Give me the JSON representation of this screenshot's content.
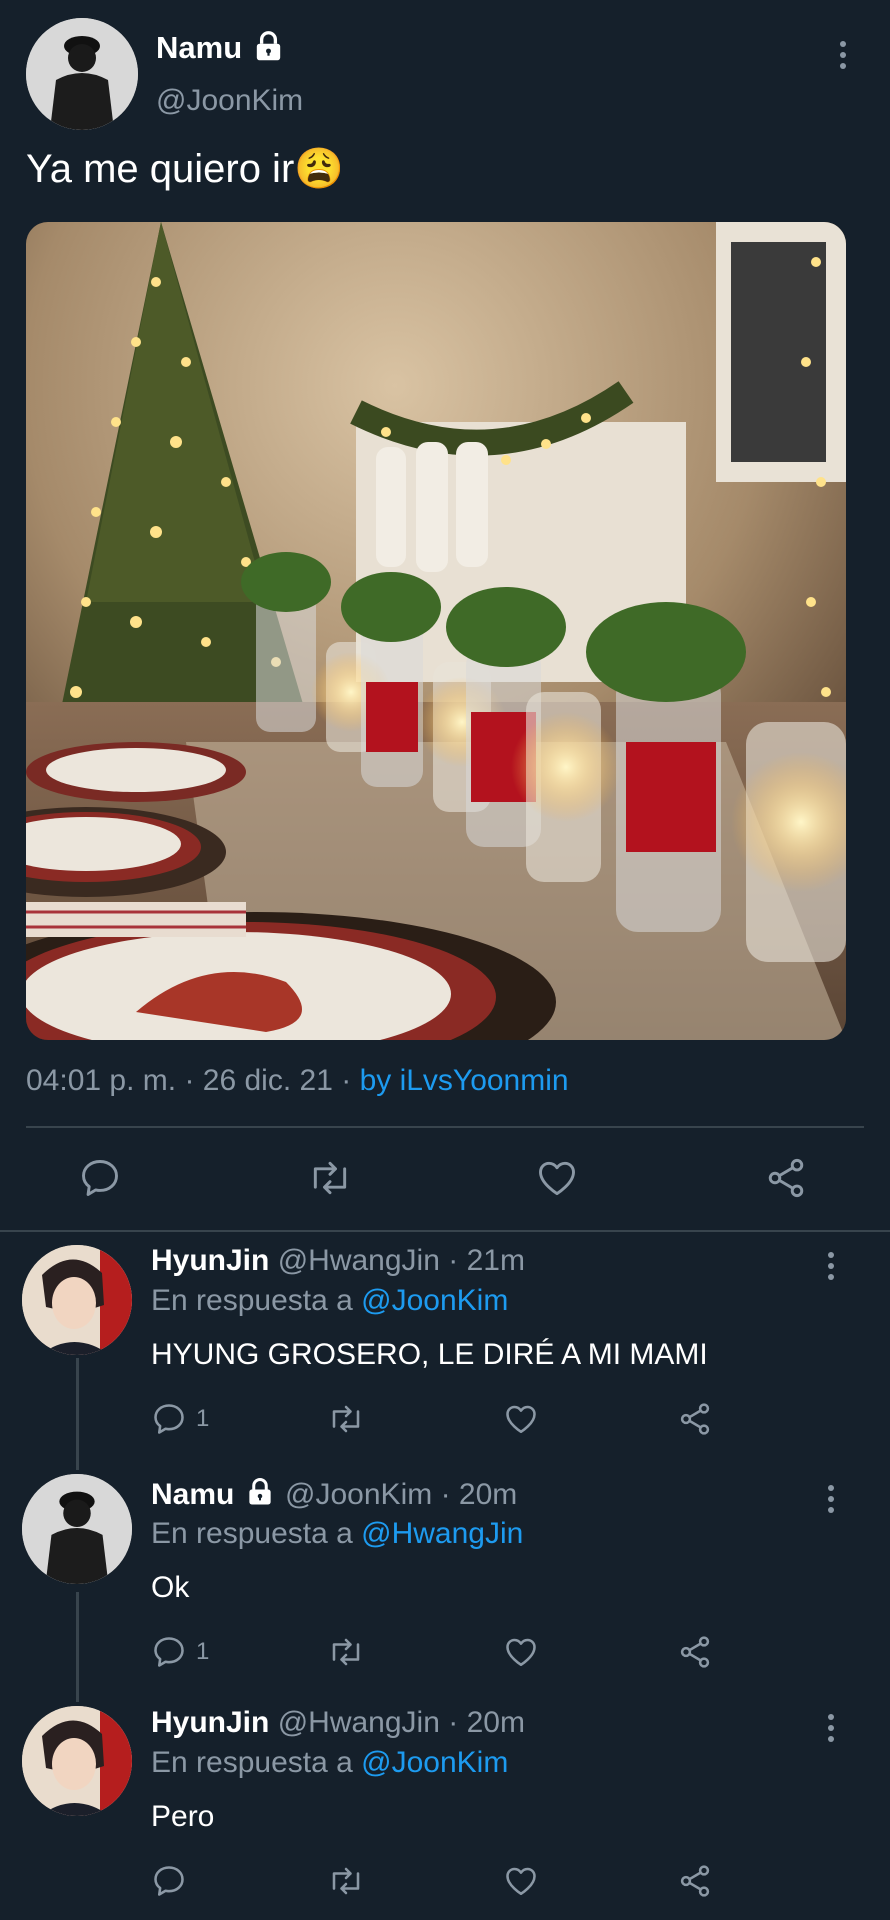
{
  "main_tweet": {
    "author_name": "Namu",
    "author_handle": "@JoonKim",
    "text": "Ya me quiero ir",
    "emoji": "😩",
    "time": "04:01 p. m.",
    "sep1": "·",
    "date": "26 dic. 21",
    "sep2": "·",
    "source": "by iLvsYoonmin",
    "locked": true
  },
  "icons": {
    "reply": "reply-icon",
    "retweet": "retweet-icon",
    "like": "heart-icon",
    "share": "share-icon",
    "more": "more-vertical-icon",
    "lock": "lock-icon"
  },
  "replies": [
    {
      "name": "HyunJin",
      "handle": "@HwangJin",
      "sep": "·",
      "time": "21m",
      "reply_prefix": "En respuesta a",
      "reply_to": "@JoonKim",
      "text": "HYUNG GROSERO, LE DIRÉ A MI MAMI",
      "reply_count": "1"
    },
    {
      "name": "Namu",
      "handle": "@JoonKim",
      "sep": "·",
      "time": "20m",
      "reply_prefix": "En respuesta a",
      "reply_to": "@HwangJin",
      "text": "Ok",
      "reply_count": "1",
      "locked": true
    },
    {
      "name": "HyunJin",
      "handle": "@HwangJin",
      "sep": "·",
      "time": "20m",
      "reply_prefix": "En respuesta a",
      "reply_to": "@JoonKim",
      "text": "Pero",
      "reply_count": ""
    }
  ],
  "colors": {
    "background": "#15202b",
    "muted": "#8b98a5",
    "link": "#1d9bf0",
    "divider": "#38444d"
  }
}
